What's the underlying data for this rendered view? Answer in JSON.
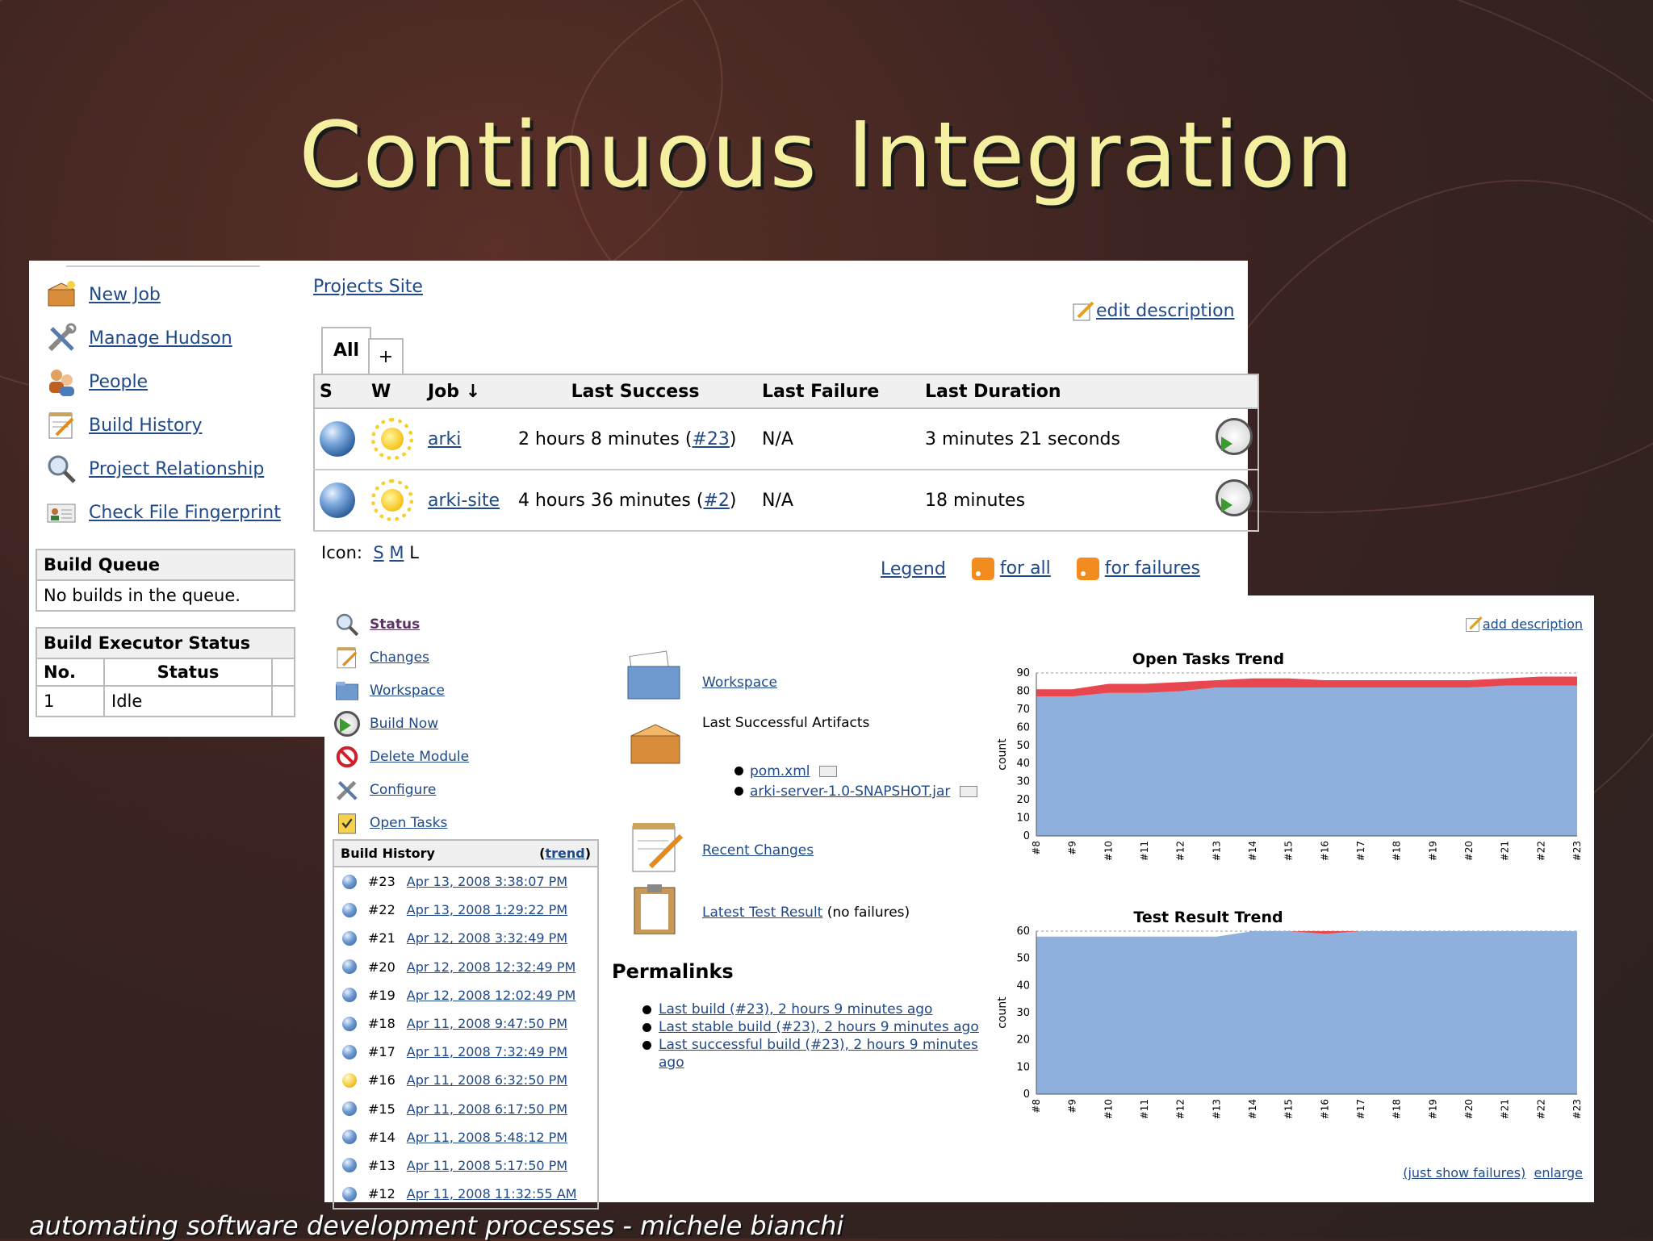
{
  "slide": {
    "title": "Continuous Integration",
    "footer": "automating software development processes - michele bianchi"
  },
  "sidebar": {
    "items": [
      {
        "label": "New Job",
        "icon": "package-icon"
      },
      {
        "label": "Manage Hudson",
        "icon": "tools-icon"
      },
      {
        "label": "People",
        "icon": "people-icon"
      },
      {
        "label": "Build History",
        "icon": "notepad-icon"
      },
      {
        "label": "Project Relationship",
        "icon": "magnifier-icon"
      },
      {
        "label": "Check File Fingerprint",
        "icon": "fingerprint-icon"
      }
    ],
    "build_queue": {
      "title": "Build Queue",
      "text": "No builds in the queue."
    },
    "executor": {
      "title": "Build Executor Status",
      "col_no": "No.",
      "col_status": "Status",
      "no": "1",
      "status": "Idle"
    }
  },
  "dashboard": {
    "breadcrumb": "Projects Site",
    "edit_description": "edit description",
    "tab_all": "All",
    "tab_add": "+",
    "columns": {
      "s": "S",
      "w": "W",
      "job": "Job ↓",
      "last_success": "Last Success",
      "last_failure": "Last Failure",
      "last_duration": "Last Duration"
    },
    "jobs": [
      {
        "name": "arki",
        "ls_text": "2 hours 8 minutes (",
        "ls_build": "#23",
        "ls_end": ")",
        "last_failure": "N/A",
        "last_duration": "3 minutes 21 seconds"
      },
      {
        "name": "arki-site",
        "ls_text": "4 hours 36 minutes (",
        "ls_build": "#2",
        "ls_end": ")",
        "last_failure": "N/A",
        "last_duration": "18 minutes"
      }
    ],
    "icon_label": "Icon:",
    "icon_sizes": [
      "S",
      "M",
      "L"
    ],
    "legend": "Legend",
    "rss_all": "for all",
    "rss_failures": "for failures"
  },
  "module": {
    "add_description": "add description",
    "menu": [
      {
        "label": "Status",
        "icon": "magnifier-icon"
      },
      {
        "label": "Changes",
        "icon": "notepad-icon"
      },
      {
        "label": "Workspace",
        "icon": "folder-icon"
      },
      {
        "label": "Build Now",
        "icon": "clock-icon"
      },
      {
        "label": "Delete Module",
        "icon": "no-entry-icon"
      },
      {
        "label": "Configure",
        "icon": "tools-icon"
      },
      {
        "label": "Open Tasks",
        "icon": "tasks-icon"
      }
    ],
    "build_history": {
      "title": "Build History",
      "trend_open": "(",
      "trend": "trend",
      "trend_close": ")",
      "rows": [
        {
          "num": "#23",
          "date": "Apr 13, 2008 3:38:07 PM",
          "status": "blue"
        },
        {
          "num": "#22",
          "date": "Apr 13, 2008 1:29:22 PM",
          "status": "blue"
        },
        {
          "num": "#21",
          "date": "Apr 12, 2008 3:32:49 PM",
          "status": "blue"
        },
        {
          "num": "#20",
          "date": "Apr 12, 2008 12:32:49 PM",
          "status": "blue"
        },
        {
          "num": "#19",
          "date": "Apr 12, 2008 12:02:49 PM",
          "status": "blue"
        },
        {
          "num": "#18",
          "date": "Apr 11, 2008 9:47:50 PM",
          "status": "blue"
        },
        {
          "num": "#17",
          "date": "Apr 11, 2008 7:32:49 PM",
          "status": "blue"
        },
        {
          "num": "#16",
          "date": "Apr 11, 2008 6:32:50 PM",
          "status": "yellow"
        },
        {
          "num": "#15",
          "date": "Apr 11, 2008 6:17:50 PM",
          "status": "blue"
        },
        {
          "num": "#14",
          "date": "Apr 11, 2008 5:48:12 PM",
          "status": "blue"
        },
        {
          "num": "#13",
          "date": "Apr 11, 2008 5:17:50 PM",
          "status": "blue"
        },
        {
          "num": "#12",
          "date": "Apr 11, 2008 11:32:55 AM",
          "status": "blue"
        }
      ]
    },
    "workspace": "Workspace",
    "artifacts_title": "Last Successful Artifacts",
    "artifacts": [
      "pom.xml",
      "arki-server-1.0-SNAPSHOT.jar"
    ],
    "recent_changes": "Recent Changes",
    "latest_test": "Latest Test Result",
    "latest_test_suffix": "(no failures)",
    "permalinks_title": "Permalinks",
    "permalinks": [
      "Last build (#23), 2 hours 9 minutes ago",
      "Last stable build (#23), 2 hours 9 minutes ago",
      "Last successful build (#23), 2 hours 9 minutes ago"
    ],
    "just_show_failures": "(just show failures)",
    "enlarge": "enlarge"
  },
  "chart_data": [
    {
      "type": "area",
      "title": "Open Tasks Trend",
      "ylabel": "count",
      "xlabel": "",
      "x": [
        "#8",
        "#9",
        "#10",
        "#11",
        "#12",
        "#13",
        "#14",
        "#15",
        "#16",
        "#17",
        "#18",
        "#19",
        "#20",
        "#21",
        "#22",
        "#23"
      ],
      "ylim": [
        0,
        90
      ],
      "yticks": [
        0,
        10,
        20,
        30,
        40,
        50,
        60,
        70,
        80,
        90
      ],
      "grid": true,
      "stacked": true,
      "colors": {
        "series1": "#8fb0dc",
        "series2": "#e8474f"
      },
      "series": [
        {
          "values": [
            77,
            77,
            79,
            79,
            80,
            82,
            82,
            82,
            82,
            82,
            82,
            82,
            82,
            83,
            83,
            83
          ]
        },
        {
          "values": [
            4,
            4,
            5,
            5,
            5,
            4,
            5,
            5,
            4,
            4,
            4,
            4,
            4,
            4,
            5,
            5
          ]
        }
      ]
    },
    {
      "type": "area",
      "title": "Test Result Trend",
      "ylabel": "count",
      "xlabel": "",
      "x": [
        "#8",
        "#9",
        "#10",
        "#11",
        "#12",
        "#13",
        "#14",
        "#15",
        "#16",
        "#17",
        "#18",
        "#19",
        "#20",
        "#21",
        "#22",
        "#23"
      ],
      "ylim": [
        0,
        60
      ],
      "yticks": [
        0,
        10,
        20,
        30,
        40,
        50,
        60
      ],
      "grid": true,
      "stacked": true,
      "colors": {
        "series1": "#8fb0dc",
        "series2": "#e8474f"
      },
      "series": [
        {
          "values": [
            58,
            58,
            58,
            58,
            58,
            58,
            60,
            60,
            59,
            60,
            60,
            60,
            60,
            60,
            60,
            60
          ]
        },
        {
          "values": [
            0,
            0,
            0,
            0,
            0,
            0,
            0,
            0,
            1,
            0,
            0,
            0,
            0,
            0,
            0,
            0
          ]
        }
      ]
    }
  ]
}
